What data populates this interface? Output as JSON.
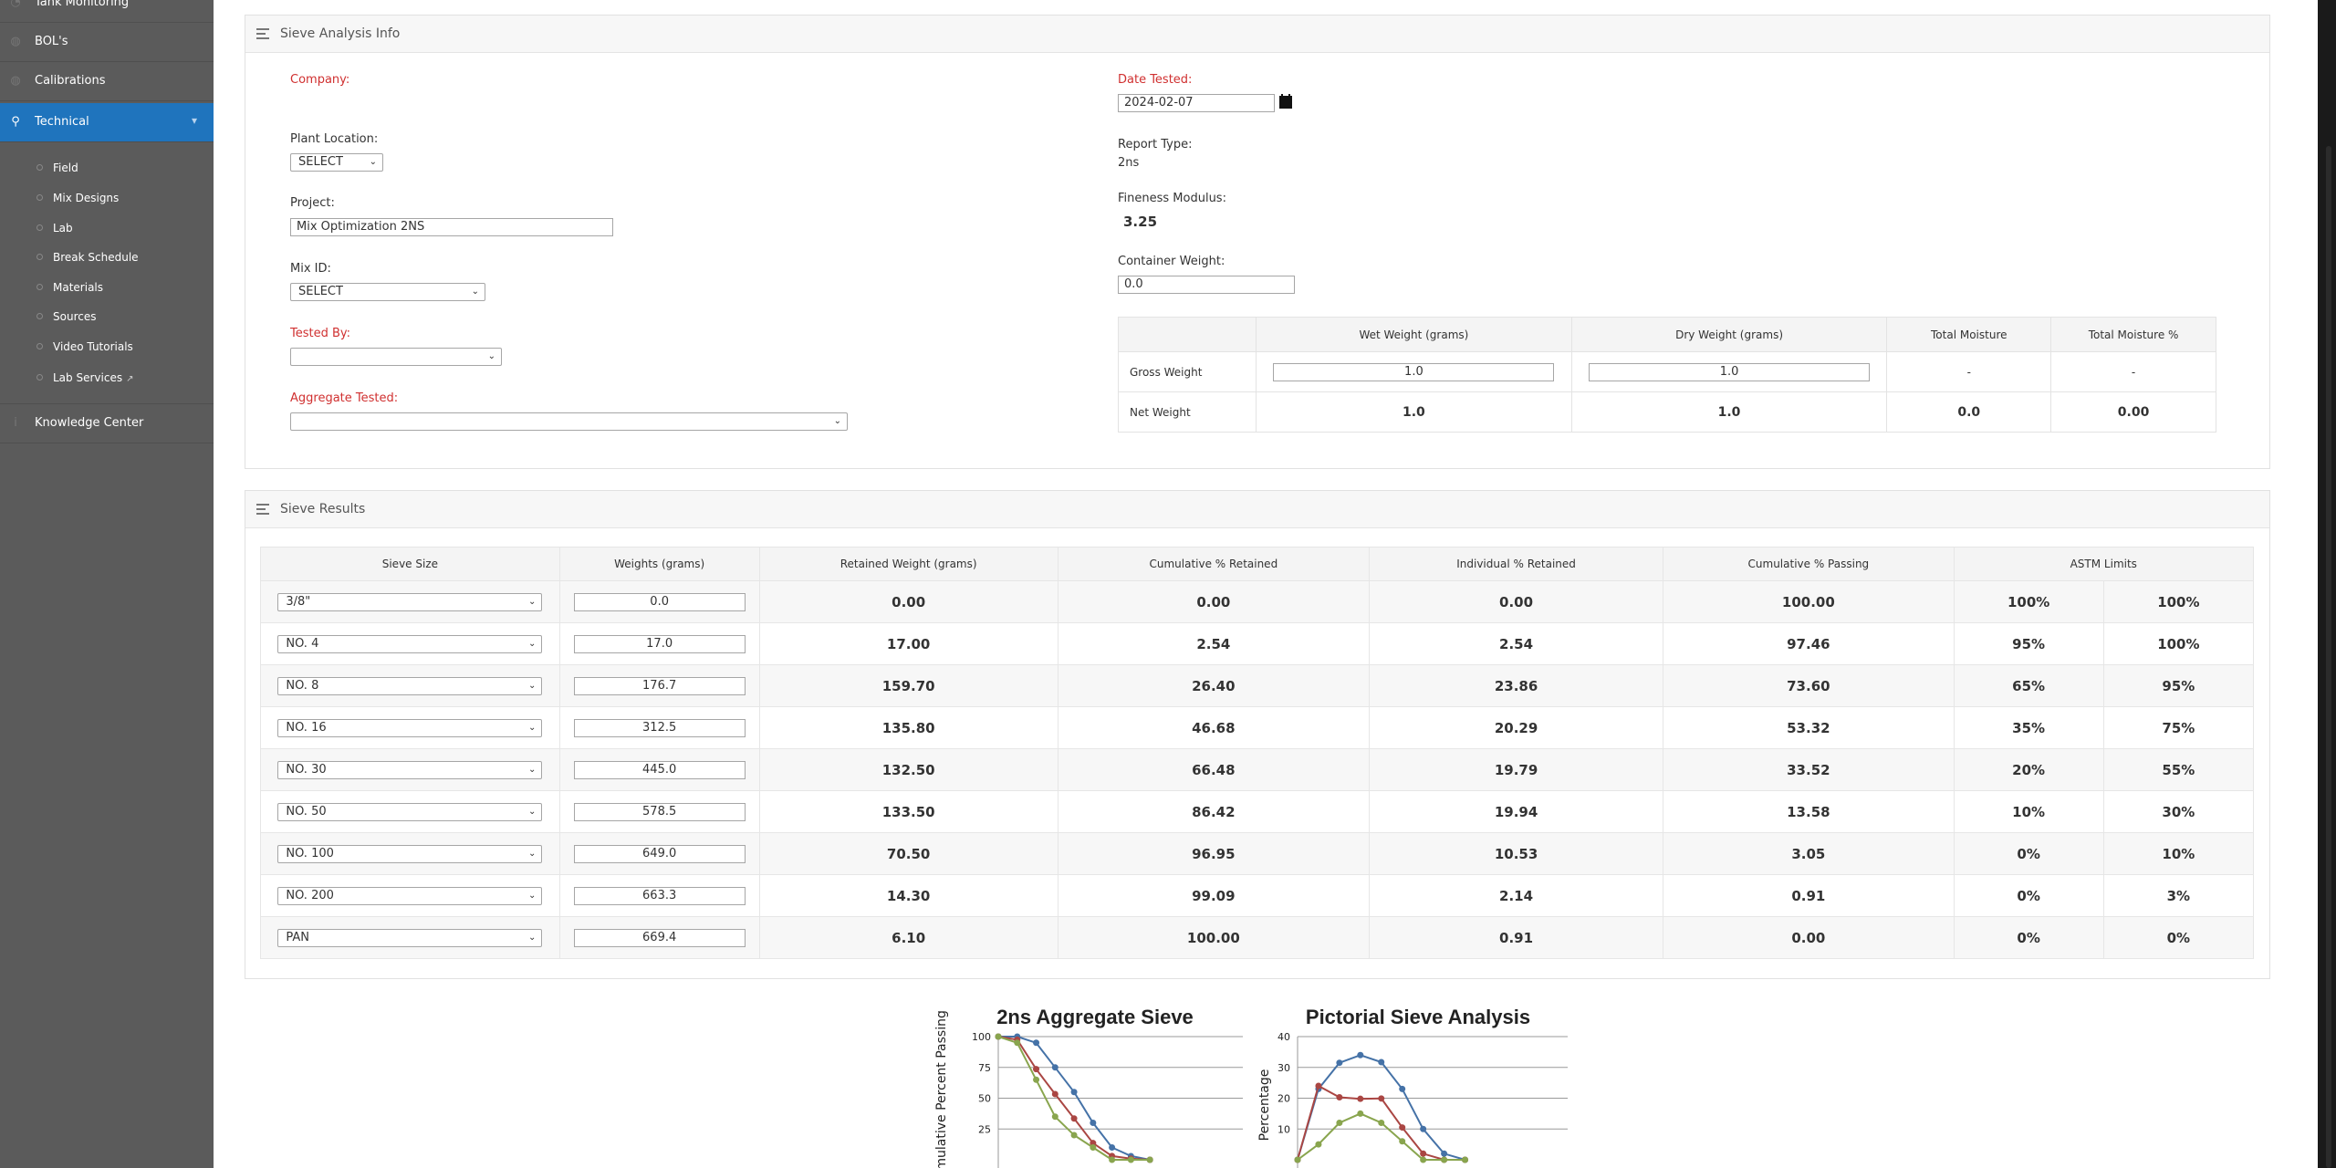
{
  "sidebar": {
    "items": [
      {
        "label": "Tank Monitoring",
        "icon": "gauge-icon"
      },
      {
        "label": "BOL's",
        "icon": "globe-icon"
      },
      {
        "label": "Calibrations",
        "icon": "globe-icon"
      },
      {
        "label": "Technical",
        "icon": "wrench-icon"
      },
      {
        "label": "Knowledge Center",
        "icon": "info-icon"
      }
    ],
    "subitems": [
      "Field",
      "Mix Designs",
      "Lab",
      "Break Schedule",
      "Materials",
      "Sources",
      "Video Tutorials",
      "Lab Services"
    ]
  },
  "info": {
    "title": "Sieve Analysis Info",
    "company_label": "Company:",
    "plant_label": "Plant Location:",
    "plant_value": "SELECT",
    "project_label": "Project:",
    "project_value": "Mix Optimization 2NS",
    "mix_label": "Mix ID:",
    "mix_value": "SELECT",
    "tested_by_label": "Tested By:",
    "tested_by_value": "",
    "aggregate_label": "Aggregate Tested:",
    "aggregate_value": "",
    "date_label": "Date Tested:",
    "date_value": "2024-02-07",
    "report_label": "Report Type:",
    "report_value": "2ns",
    "fineness_label": "Fineness Modulus:",
    "fineness_value": "3.25",
    "container_label": "Container Weight:",
    "container_value": "0.0"
  },
  "moisture": {
    "headers": [
      "",
      "Wet Weight (grams)",
      "Dry Weight (grams)",
      "Total Moisture",
      "Total Moisture %"
    ],
    "gross": {
      "label": "Gross Weight",
      "wet": "1.0",
      "dry": "1.0",
      "tm": "-",
      "tmp": "-"
    },
    "net": {
      "label": "Net Weight",
      "wet": "1.0",
      "dry": "1.0",
      "tm": "0.0",
      "tmp": "0.00"
    }
  },
  "results": {
    "title": "Sieve Results",
    "headers": [
      "Sieve Size",
      "Weights (grams)",
      "Retained Weight (grams)",
      "Cumulative % Retained",
      "Individual % Retained",
      "Cumulative % Passing",
      "ASTM Limits"
    ],
    "rows": [
      {
        "size": "3/8\"",
        "weight": "0.0",
        "retained": "0.00",
        "cum_ret": "0.00",
        "ind_ret": "0.00",
        "cum_pass": "100.00",
        "lim_lo": "100%",
        "lim_hi": "100%"
      },
      {
        "size": "NO. 4",
        "weight": "17.0",
        "retained": "17.00",
        "cum_ret": "2.54",
        "ind_ret": "2.54",
        "cum_pass": "97.46",
        "lim_lo": "95%",
        "lim_hi": "100%"
      },
      {
        "size": "NO. 8",
        "weight": "176.7",
        "retained": "159.70",
        "cum_ret": "26.40",
        "ind_ret": "23.86",
        "cum_pass": "73.60",
        "lim_lo": "65%",
        "lim_hi": "95%"
      },
      {
        "size": "NO. 16",
        "weight": "312.5",
        "retained": "135.80",
        "cum_ret": "46.68",
        "ind_ret": "20.29",
        "cum_pass": "53.32",
        "lim_lo": "35%",
        "lim_hi": "75%"
      },
      {
        "size": "NO. 30",
        "weight": "445.0",
        "retained": "132.50",
        "cum_ret": "66.48",
        "ind_ret": "19.79",
        "cum_pass": "33.52",
        "lim_lo": "20%",
        "lim_hi": "55%"
      },
      {
        "size": "NO. 50",
        "weight": "578.5",
        "retained": "133.50",
        "cum_ret": "86.42",
        "ind_ret": "19.94",
        "cum_pass": "13.58",
        "lim_lo": "10%",
        "lim_hi": "30%"
      },
      {
        "size": "NO. 100",
        "weight": "649.0",
        "retained": "70.50",
        "cum_ret": "96.95",
        "ind_ret": "10.53",
        "cum_pass": "3.05",
        "lim_lo": "0%",
        "lim_hi": "10%"
      },
      {
        "size": "NO. 200",
        "weight": "663.3",
        "retained": "14.30",
        "cum_ret": "99.09",
        "ind_ret": "2.14",
        "cum_pass": "0.91",
        "lim_lo": "0%",
        "lim_hi": "3%"
      },
      {
        "size": "PAN",
        "weight": "669.4",
        "retained": "6.10",
        "cum_ret": "100.00",
        "ind_ret": "0.91",
        "cum_pass": "0.00",
        "lim_lo": "0%",
        "lim_hi": "0%"
      }
    ]
  },
  "chart_data": [
    {
      "type": "line",
      "title": "2ns Aggregate Sieve",
      "ylabel": "Cummulative Percent Passing",
      "ylim": [
        0,
        100
      ],
      "yticks": [
        25,
        50,
        75,
        100
      ],
      "x": [
        0,
        1,
        2,
        3,
        4,
        5,
        6,
        7,
        8
      ],
      "series": [
        {
          "color": "#4572a7",
          "values": [
            100,
            100,
            95,
            75,
            55,
            30,
            10,
            3,
            0
          ]
        },
        {
          "color": "#aa4643",
          "values": [
            100,
            97.46,
            73.6,
            53.32,
            33.52,
            13.58,
            3.05,
            0.91,
            0
          ]
        },
        {
          "color": "#89a54e",
          "values": [
            100,
            95,
            65,
            35,
            20,
            10,
            0,
            0,
            0
          ]
        }
      ]
    },
    {
      "type": "line",
      "title": "Pictorial Sieve Analysis",
      "ylabel": "Percentage",
      "ylim": [
        0,
        40
      ],
      "yticks": [
        10,
        20,
        30,
        40
      ],
      "x": [
        0,
        1,
        2,
        3,
        4,
        5,
        6,
        7,
        8
      ],
      "series": [
        {
          "color": "#4572a7",
          "values": [
            0,
            23,
            31.5,
            34,
            31.7,
            23,
            10,
            2,
            0
          ]
        },
        {
          "color": "#aa4643",
          "values": [
            0,
            24,
            20.3,
            19.8,
            19.9,
            10.5,
            2,
            0,
            0
          ]
        },
        {
          "color": "#89a54e",
          "values": [
            0,
            5,
            12,
            15,
            12,
            6,
            0,
            0,
            0
          ]
        }
      ]
    }
  ]
}
